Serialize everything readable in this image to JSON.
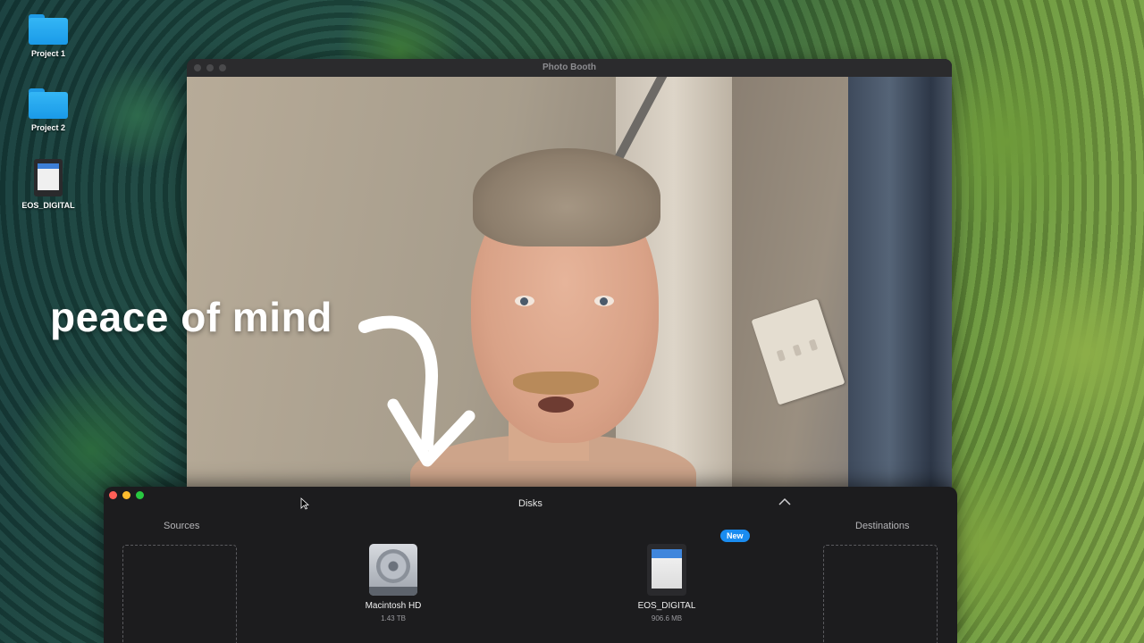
{
  "desktop": {
    "icons": [
      {
        "label": "Project 1",
        "icon": "folder-icon"
      },
      {
        "label": "Project 2",
        "icon": "folder-icon"
      },
      {
        "label": "EOS_DIGITAL",
        "icon": "sd-card-icon"
      }
    ]
  },
  "photobooth": {
    "title": "Photo Booth"
  },
  "overlay": {
    "caption": "peace of mind"
  },
  "disks_window": {
    "title": "Disks",
    "sources_label": "Sources",
    "destinations_label": "Destinations",
    "disks": [
      {
        "name": "Macintosh HD",
        "size": "1.43 TB",
        "icon": "hard-drive-icon",
        "badge": ""
      },
      {
        "name": "EOS_DIGITAL",
        "size": "906.6 MB",
        "icon": "sd-card-icon",
        "badge": "New"
      }
    ]
  },
  "colors": {
    "accent": "#1a8cf0",
    "close": "#ff5f57",
    "minimize": "#febc2e",
    "maximize": "#28c840",
    "window_bg": "#1c1c1e",
    "folder": "#34b6f5"
  }
}
